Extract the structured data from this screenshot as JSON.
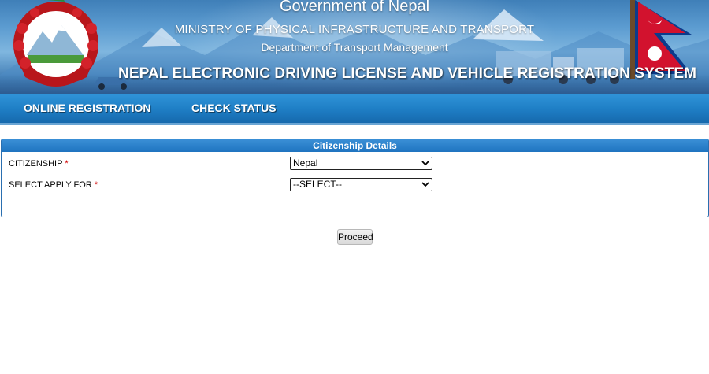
{
  "header": {
    "government": "Government of Nepal",
    "ministry": "MINISTRY OF PHYSICAL INFRASTRUCTURE AND TRANSPORT",
    "department": "Department of Transport Management",
    "system_title": "NEPAL ELECTRONIC DRIVING LICENSE AND VEHICLE REGISTRATION SYSTEM"
  },
  "nav": {
    "items": [
      {
        "label": "ONLINE REGISTRATION"
      },
      {
        "label": "CHECK STATUS"
      }
    ]
  },
  "panel": {
    "title": "Citizenship Details",
    "fields": [
      {
        "label": "CITIZENSHIP",
        "required_mark": "*",
        "value": "Nepal"
      },
      {
        "label": "SELECT APPLY FOR",
        "required_mark": "*",
        "value": "--SELECT--"
      }
    ]
  },
  "actions": {
    "proceed_label": "Proceed"
  },
  "colors": {
    "nav_blue": "#1f7fc6",
    "panel_header_blue": "#2a7fc8",
    "required_red": "#d00000"
  }
}
